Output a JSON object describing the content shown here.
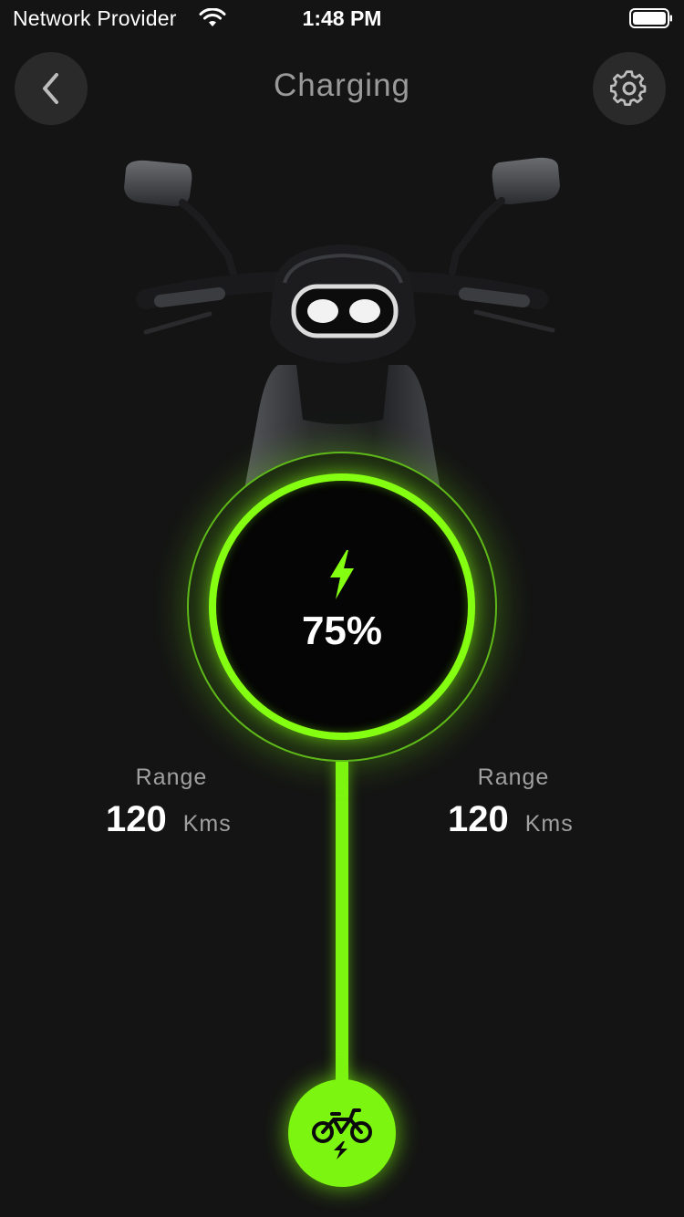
{
  "status_bar": {
    "carrier": "Network Provider",
    "time": "1:48 PM",
    "wifi_icon": "wifi-icon",
    "battery_icon": "battery-icon"
  },
  "header": {
    "title": "Charging",
    "back_icon": "chevron-left-icon",
    "settings_icon": "gear-icon"
  },
  "vehicle": {
    "image": "scooter-front-view"
  },
  "battery": {
    "percent_text": "75%",
    "percent_value": 75,
    "icon": "lightning-bolt-icon"
  },
  "ranges": [
    {
      "label": "Range",
      "value": "120",
      "unit": "Kms"
    },
    {
      "label": "Range",
      "value": "120",
      "unit": "Kms"
    }
  ],
  "charge_button": {
    "icon": "bike-charging-icon"
  },
  "colors": {
    "background": "#141414",
    "accent": "#7cf510",
    "button_bg": "#2a2a2a",
    "muted_text": "#a0a0a0"
  }
}
